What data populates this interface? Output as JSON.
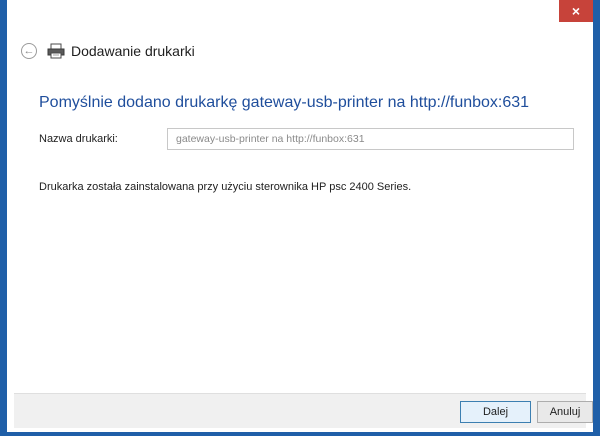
{
  "window": {
    "close_symbol": "×"
  },
  "header": {
    "back_icon": "back-arrow-icon",
    "back_symbol": "←",
    "printer_icon": "printer-icon",
    "title": "Dodawanie drukarki"
  },
  "main": {
    "heading": "Pomyślnie dodano drukarkę gateway-usb-printer na http://funbox:631",
    "name_label": "Nazwa drukarki:",
    "name_value": "gateway-usb-printer na http://funbox:631",
    "status": "Drukarka została zainstalowana przy użyciu sterownika HP psc 2400 Series."
  },
  "footer": {
    "next_label": "Dalej",
    "cancel_label": "Anuluj"
  },
  "colors": {
    "accent": "#1f5fa8",
    "heading": "#1f4e9c",
    "close": "#c7433a"
  }
}
